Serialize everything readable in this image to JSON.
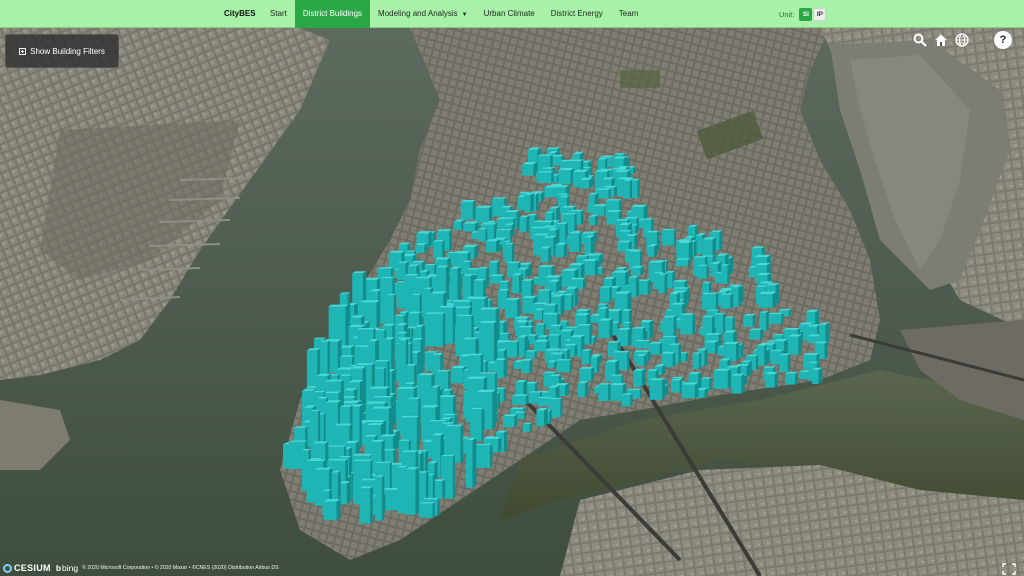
{
  "navbar": {
    "brand": "CityBES",
    "items": [
      {
        "label": "Start",
        "active": false
      },
      {
        "label": "District Buildings",
        "active": true
      },
      {
        "label": "Modeling and Analysis",
        "active": false,
        "dropdown": true
      },
      {
        "label": "Urban Climate",
        "active": false
      },
      {
        "label": "District Energy",
        "active": false
      },
      {
        "label": "Team",
        "active": false
      }
    ],
    "unit_label": "Unit:",
    "unit_options": [
      "SI",
      "IP"
    ],
    "unit_selected": "SI"
  },
  "filter_button": {
    "label": "Show Building Filters",
    "icon": "plus-square-icon"
  },
  "toolbar": {
    "icons": [
      "search-icon",
      "home-icon",
      "globe-icon"
    ],
    "help_label": "?"
  },
  "credits": {
    "cesium": "CESIUM",
    "bing": "bing",
    "attribution": "© 2020 Microsoft Corporation • © 2020 Maxar • ©CNES (2020) Distribution Airbus DS"
  },
  "colors": {
    "navbar": "#a9f0a9",
    "active_tab": "#2aa845",
    "buildings": "#1fb5b5",
    "water": "#4e5d50",
    "land": "#6a6b62"
  }
}
